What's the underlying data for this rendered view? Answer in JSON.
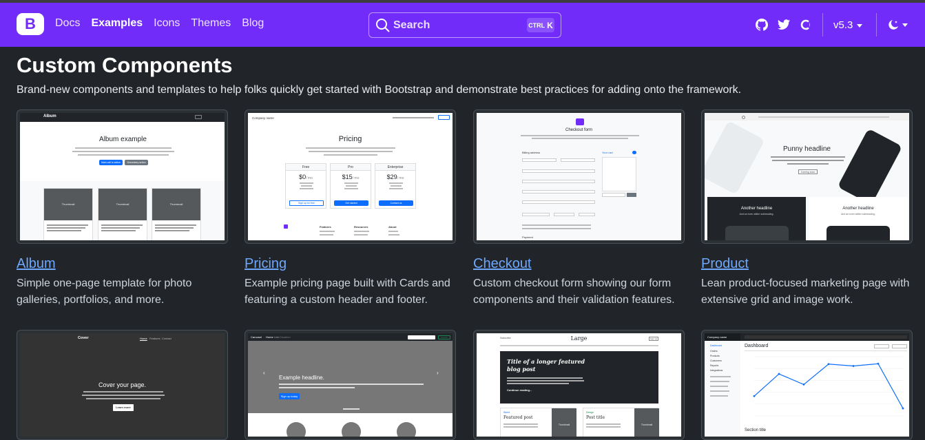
{
  "nav": {
    "brand": "B",
    "links": [
      "Docs",
      "Examples",
      "Icons",
      "Themes",
      "Blog"
    ],
    "active": "Examples",
    "search_placeholder": "Search",
    "search_kbd_ctrl": "CTRL",
    "search_kbd_key": "K",
    "version": "v5.3",
    "accent": "#712cf9"
  },
  "page": {
    "title": "Custom Components",
    "subtitle": "Brand-new components and templates to help folks quickly get started with Bootstrap and demonstrate best practices for adding onto the framework."
  },
  "examples": [
    {
      "name": "Album",
      "desc": "Simple one-page template for photo galleries, portfolios, and more."
    },
    {
      "name": "Pricing",
      "desc": "Example pricing page built with Cards and featuring a custom header and footer."
    },
    {
      "name": "Checkout",
      "desc": "Custom checkout form showing our form components and their validation features."
    },
    {
      "name": "Product",
      "desc": "Lean product-focused marketing page with extensive grid and image work."
    }
  ],
  "thumbs": {
    "album": {
      "nav": "Album",
      "heading": "Album example",
      "btn1": "Main call to action",
      "btn2": "Secondary action",
      "card_label": "Thumbnail"
    },
    "pricing": {
      "company": "Company name",
      "heading": "Pricing",
      "plans": [
        "Free",
        "Pro",
        "Enterprise"
      ],
      "prices": [
        "$0",
        "$15",
        "$29"
      ],
      "per": "/ mo",
      "buttons": [
        "Sign up for free",
        "Get started",
        "Contact us"
      ],
      "footer_cols": [
        "Features",
        "Resources",
        "About"
      ]
    },
    "checkout": {
      "heading": "Checkout form",
      "billing": "Billing address",
      "cart": "Your cart",
      "payment": "Payment"
    },
    "product": {
      "headline": "Punny headline",
      "cta": "Coming soon",
      "another": "Another headline",
      "another_sub": "And an even wittier subheading."
    },
    "cover": {
      "brand": "Cover",
      "nav": [
        "Home",
        "Features",
        "Contact"
      ],
      "heading": "Cover your page.",
      "btn": "Learn more"
    },
    "carousel": {
      "brand": "Carousel",
      "nav": [
        "Home",
        "Link",
        "Disabled"
      ],
      "heading": "Example headline.",
      "btn": "Sign up today",
      "search_btn": "Search"
    },
    "blog": {
      "subscribe": "Subscribe",
      "brand": "Large",
      "signup": "Sign up",
      "feature_title": "Title of a longer featured blog post",
      "continue": "Continue reading...",
      "post1": "Featured post",
      "post1_tag": "World",
      "post2": "Post title",
      "post2_tag": "Design",
      "thumb": "Thumbnail"
    },
    "dashboard": {
      "company": "Company name",
      "heading": "Dashboard",
      "section": "Section title",
      "sidebar": [
        "Dashboard",
        "Orders",
        "Products",
        "Customers",
        "Reports",
        "Integrations"
      ],
      "chart": [
        15339,
        21345,
        18483,
        24003,
        23489,
        24092,
        12034
      ]
    }
  }
}
